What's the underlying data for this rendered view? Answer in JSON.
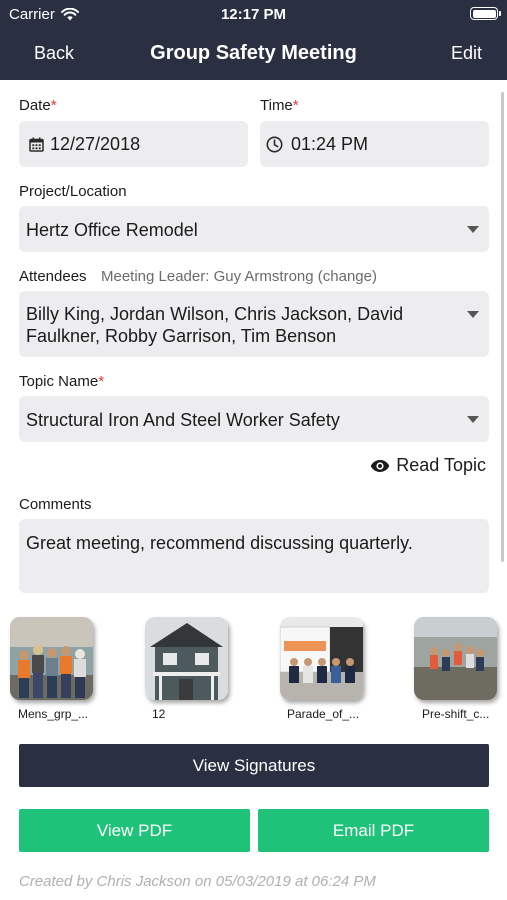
{
  "status_bar": {
    "carrier": "Carrier",
    "time": "12:17 PM"
  },
  "nav": {
    "back": "Back",
    "title": "Group Safety Meeting",
    "edit": "Edit"
  },
  "form": {
    "date_label": "Date",
    "date_value": "12/27/2018",
    "time_label": "Time",
    "time_value": "01:24 PM",
    "project_label": "Project/Location",
    "project_value": "Hertz Office Remodel",
    "attendees_label": "Attendees",
    "meeting_leader": "Meeting Leader: Guy Armstrong (change)",
    "attendees_line1": "Billy King, Jordan Wilson, Chris Jackson, David",
    "attendees_line2": "Faulkner, Robby Garrison, Tim Benson",
    "topic_label": "Topic Name",
    "topic_value": "Structural Iron And Steel Worker Safety",
    "read_topic": "Read Topic",
    "comments_label": "Comments",
    "comments_value": "Great meeting, recommend discussing quarterly.",
    "required_mark": "*"
  },
  "photos": [
    {
      "caption": "Mens_grp_..."
    },
    {
      "caption": "12"
    },
    {
      "caption": "Parade_of_..."
    },
    {
      "caption": "Pre-shift_c..."
    }
  ],
  "actions": {
    "view_signatures": "View Signatures",
    "view_pdf": "View PDF",
    "email_pdf": "Email PDF"
  },
  "footer": {
    "created_by": "Created by Chris Jackson on 05/03/2019 at 06:24 PM"
  },
  "colors": {
    "header": "#2a3042",
    "green": "#1fc279",
    "required": "#e53935",
    "field_bg": "#ededf0"
  },
  "icons": [
    "wifi-icon",
    "battery-icon",
    "calendar-icon",
    "clock-icon",
    "caret-down-icon",
    "eye-icon"
  ]
}
